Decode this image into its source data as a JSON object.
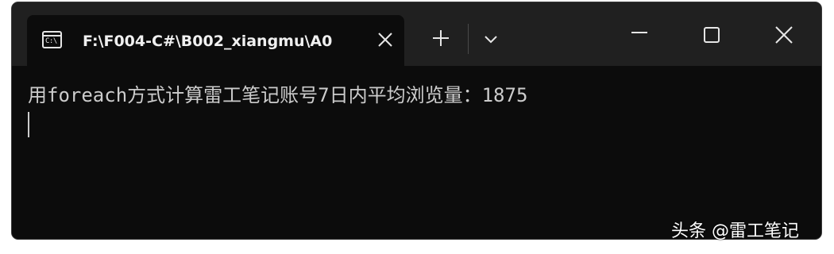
{
  "tab": {
    "title": "F:\\F004-C#\\B002_xiangmu\\A0",
    "icon": "terminal-icon",
    "icon_text": "C:\\",
    "close_icon": "close-icon"
  },
  "titlebar": {
    "new_tab_icon": "plus-icon",
    "dropdown_icon": "chevron-down-icon",
    "minimize_icon": "minimize-icon",
    "maximize_icon": "maximize-icon",
    "close_icon": "close-icon"
  },
  "terminal": {
    "output": "用foreach方式计算雷工笔记账号7日内平均浏览量：1875"
  },
  "watermark": {
    "text": "头条 @雷工笔记"
  },
  "colors": {
    "titlebar_bg": "#202020",
    "terminal_bg": "#0c0c0c",
    "text": "#cccccc",
    "icon": "#e6e6e6"
  }
}
